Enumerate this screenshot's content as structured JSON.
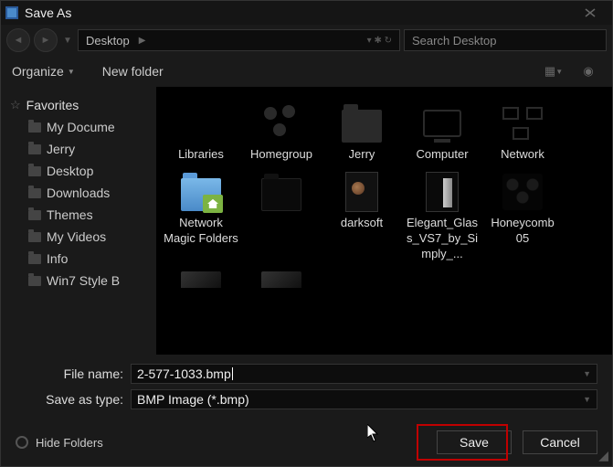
{
  "titlebar": {
    "title": "Save As"
  },
  "breadcrumb": {
    "location": "Desktop"
  },
  "search": {
    "placeholder": "Search Desktop"
  },
  "toolbar": {
    "organize": "Organize",
    "new_folder": "New folder"
  },
  "sidebar": {
    "group": "Favorites",
    "items": [
      {
        "label": "My Docume"
      },
      {
        "label": "Jerry"
      },
      {
        "label": "Desktop"
      },
      {
        "label": "Downloads"
      },
      {
        "label": "Themes"
      },
      {
        "label": "My Videos"
      },
      {
        "label": "Info"
      },
      {
        "label": "Win7 Style B"
      }
    ]
  },
  "files": [
    {
      "label": "Libraries",
      "icon": "libraries"
    },
    {
      "label": "Homegroup",
      "icon": "homegroup"
    },
    {
      "label": "Jerry",
      "icon": "userfolder"
    },
    {
      "label": "Computer",
      "icon": "computer"
    },
    {
      "label": "Network",
      "icon": "network"
    },
    {
      "label": "Network Magic Folders",
      "icon": "nmf"
    },
    {
      "label": "",
      "icon": "darkfolder"
    },
    {
      "label": "darksoft",
      "icon": "darksoft"
    },
    {
      "label": "Elegant_Glass_VS7_by_Simply_...",
      "icon": "elegant"
    },
    {
      "label": "Honeycomb 05",
      "icon": "honeycomb"
    }
  ],
  "partial_files": [
    {
      "icon": "partial"
    },
    {
      "icon": "partial"
    }
  ],
  "form": {
    "file_name_label": "File name:",
    "file_name_value": "2-577-1033.bmp",
    "type_label": "Save as type:",
    "type_value": "BMP Image (*.bmp)"
  },
  "footer": {
    "hide_folders": "Hide Folders",
    "save": "Save",
    "cancel": "Cancel"
  }
}
